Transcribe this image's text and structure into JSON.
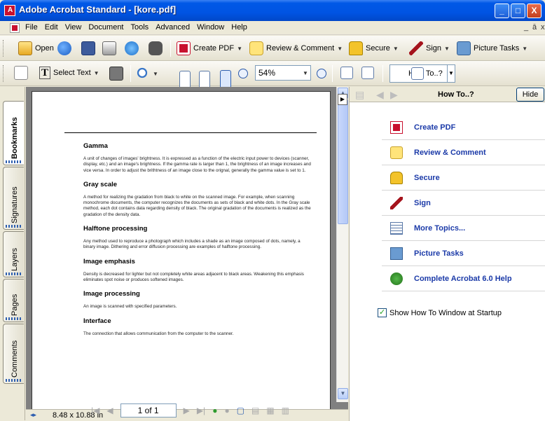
{
  "window": {
    "title": "Adobe Acrobat Standard - [kore.pdf]",
    "controls": {
      "minimize": "_",
      "maximize": "□",
      "close": "X"
    }
  },
  "menubar": {
    "items": [
      "File",
      "Edit",
      "View",
      "Document",
      "Tools",
      "Advanced",
      "Window",
      "Help"
    ],
    "doc_controls": {
      "minimize": "_",
      "restore": "ā",
      "close": "x"
    }
  },
  "toolbar1": {
    "open": "Open",
    "create_pdf": "Create PDF",
    "review_comment": "Review & Comment",
    "secure": "Secure",
    "sign": "Sign",
    "picture_tasks": "Picture Tasks"
  },
  "toolbar2": {
    "select_text": "Select Text",
    "zoom_value": "54%",
    "how_to": "How To..?"
  },
  "nav_tabs": [
    "Bookmarks",
    "Signatures",
    "Layers",
    "Pages",
    "Comments"
  ],
  "document": {
    "sections": [
      {
        "heading": "Gamma",
        "body": "A unit of changes of images' brightness. It is expressed as a function of the electric input power to devices (scanner, display, etc.) and an image's brightness. If the gamma rate is larger than 1, the brightness of an image increases and vice versa. In order to adjust the brithtness of an image close to the orignal, generally the gamma value is set to 1."
      },
      {
        "heading": "Gray scale",
        "body": "A method for realizing the gradation from black to white on the scanned image. For example, when scanning monochrome documents, the computer recognizes the documents as sets of black and white dots. In the Gray scale method, each dot contains data regarding density of black. The original gradation of the documents is realized as the gradation of the density data."
      },
      {
        "heading": "Halftone processing",
        "body": "Any method used to reproduce a photograph which includes a shade as an image composed of dots, namely, a binary image. Dithering and error diffusion processing are examples of halftone processing."
      },
      {
        "heading": "Image emphasis",
        "body": "Density is decreased for lighter but not completely white areas adjacent to black areas. Weakening this emphasis eliminates spot noise or produces softened images."
      },
      {
        "heading": "Image processing",
        "body": "An image is scanned with specified parameters."
      },
      {
        "heading": "Interface",
        "body": "The connection that allows communication from the computer to the scanner."
      }
    ],
    "page_size": "8.48 x 10.88 in",
    "page_number": "1 of 1"
  },
  "howto_panel": {
    "title": "How To..?",
    "hide_button": "Hide",
    "items": [
      {
        "label": "Create PDF",
        "icon": "create-pdf-icon"
      },
      {
        "label": "Review & Comment",
        "icon": "review-comment-icon"
      },
      {
        "label": "Secure",
        "icon": "lock-icon"
      },
      {
        "label": "Sign",
        "icon": "pen-icon"
      },
      {
        "label": "More Topics...",
        "icon": "topics-icon"
      },
      {
        "label": "Picture Tasks",
        "icon": "picture-tasks-icon"
      },
      {
        "label": "Complete Acrobat 6.0 Help",
        "icon": "help-icon"
      }
    ],
    "startup_checkbox": {
      "label": "Show How To Window at Startup",
      "checked": true
    }
  },
  "colors": {
    "titlebar": "#0054e3",
    "link": "#1b3aa8",
    "chrome": "#ece9d8"
  }
}
